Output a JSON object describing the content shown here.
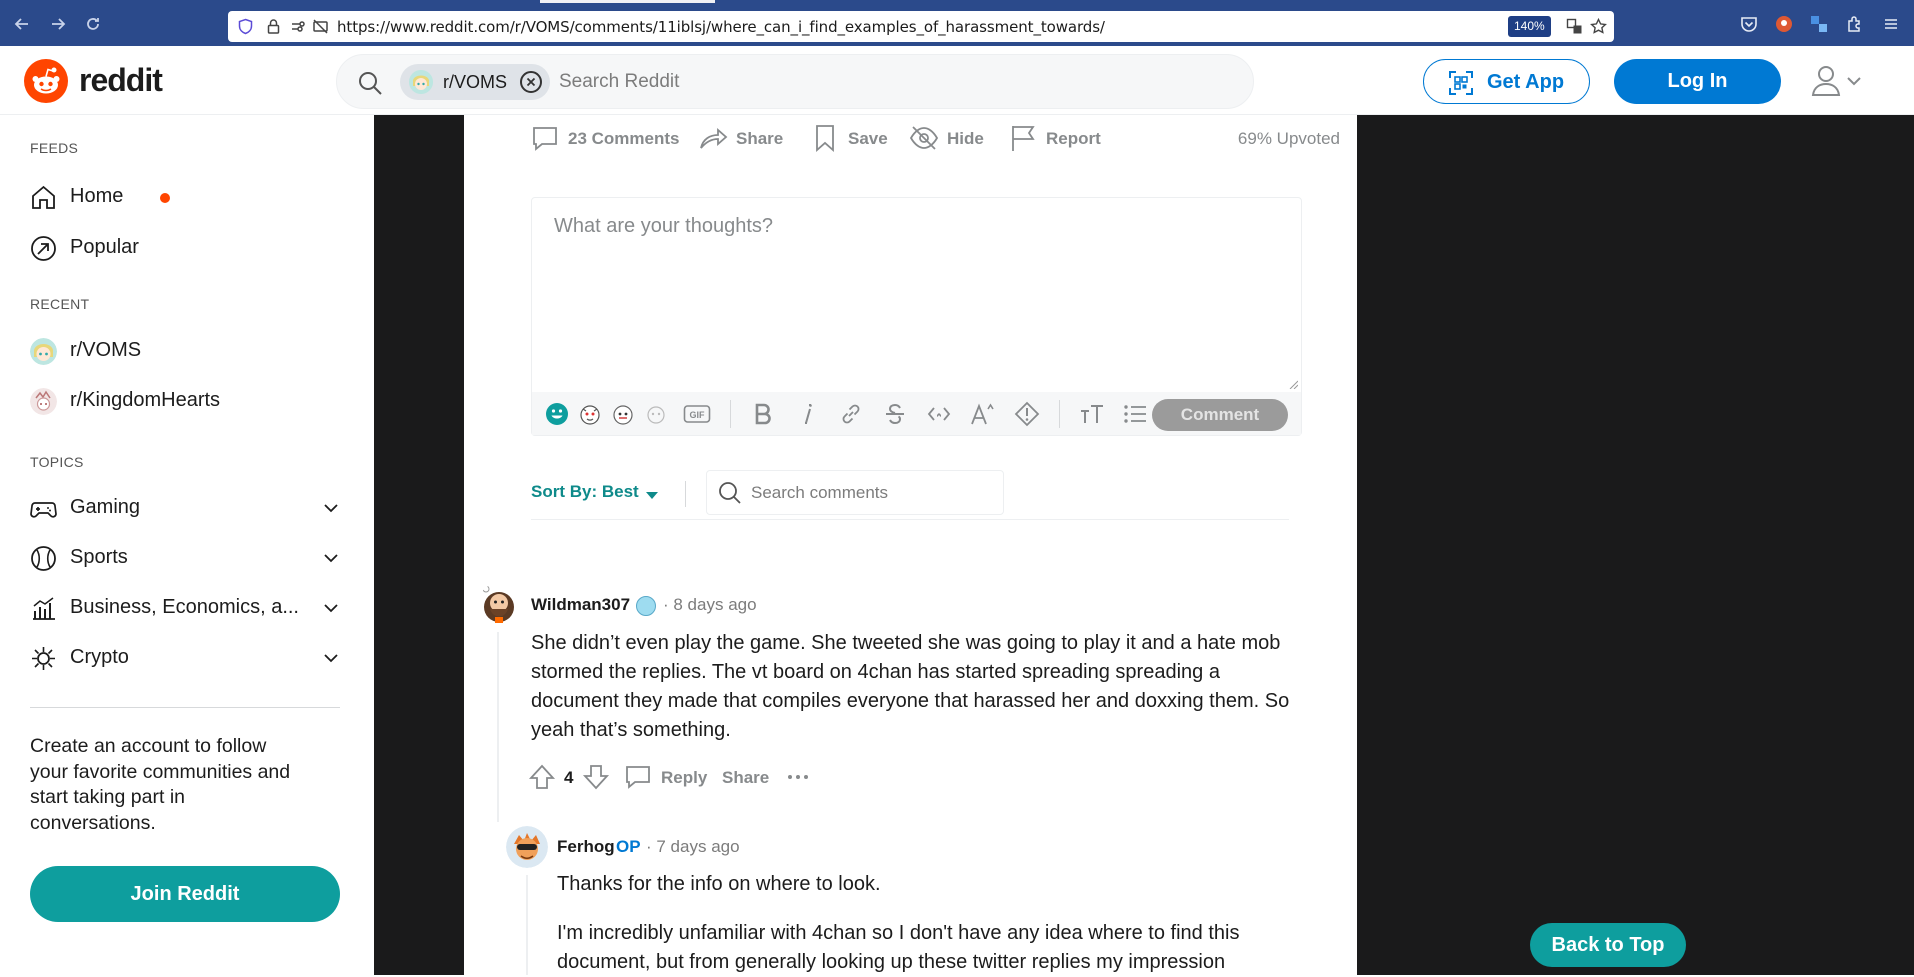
{
  "browser": {
    "url": "https://www.reddit.com/r/VOMS/comments/11iblsj/where_can_i_find_examples_of_harassment_towards/",
    "zoom": "140%"
  },
  "header": {
    "logo_text": "reddit",
    "search_chip": "r/VOMS",
    "search_placeholder": "Search Reddit",
    "get_app": "Get App",
    "log_in": "Log In"
  },
  "sidebar": {
    "feeds_title": "FEEDS",
    "feeds": [
      {
        "label": "Home",
        "icon": "home-icon"
      },
      {
        "label": "Popular",
        "icon": "popular-icon"
      }
    ],
    "recent_title": "RECENT",
    "recent": [
      {
        "label": "r/VOMS"
      },
      {
        "label": "r/KingdomHearts"
      }
    ],
    "topics_title": "TOPICS",
    "topics": [
      {
        "label": "Gaming",
        "icon": "gamepad-icon"
      },
      {
        "label": "Sports",
        "icon": "ball-icon"
      },
      {
        "label": "Business, Economics, a...",
        "icon": "chart-icon"
      },
      {
        "label": "Crypto",
        "icon": "crypto-icon"
      }
    ],
    "cta_text": "Create an account to follow your favorite communities and start taking part in conversations.",
    "join_button": "Join Reddit"
  },
  "post_actions": {
    "comments": "23 Comments",
    "share": "Share",
    "save": "Save",
    "hide": "Hide",
    "report": "Report",
    "upvoted": "69% Upvoted"
  },
  "editor": {
    "placeholder": "What are your thoughts?",
    "gif_label": "GIF",
    "comment_button": "Comment"
  },
  "sort": {
    "label": "Sort By: Best",
    "search_placeholder": "Search comments"
  },
  "comments": [
    {
      "author": "Wildman307",
      "time": "· 8 days ago",
      "body": "She didn’t even play the game. She tweeted she was going to play it and a hate mob stormed the replies. The vt board on 4chan has started spreading spreading a document they made that compiles everyone that harassed her and doxxing them. So yeah that’s something.",
      "votes": "4",
      "reply": "Reply",
      "share": "Share"
    },
    {
      "author": "Ferhog",
      "op_badge": "OP",
      "time": "· 7 days ago",
      "body_p1": "Thanks for the info on where to look.",
      "body_p2": "I'm incredibly unfamiliar with 4chan so I don't have any idea where to find this document, but from generally looking up these twitter replies my impression"
    }
  ],
  "back_to_top": "Back to Top",
  "colors": {
    "brand": "#ff4500",
    "blue": "#0079d3",
    "teal": "#0e9e9e"
  }
}
